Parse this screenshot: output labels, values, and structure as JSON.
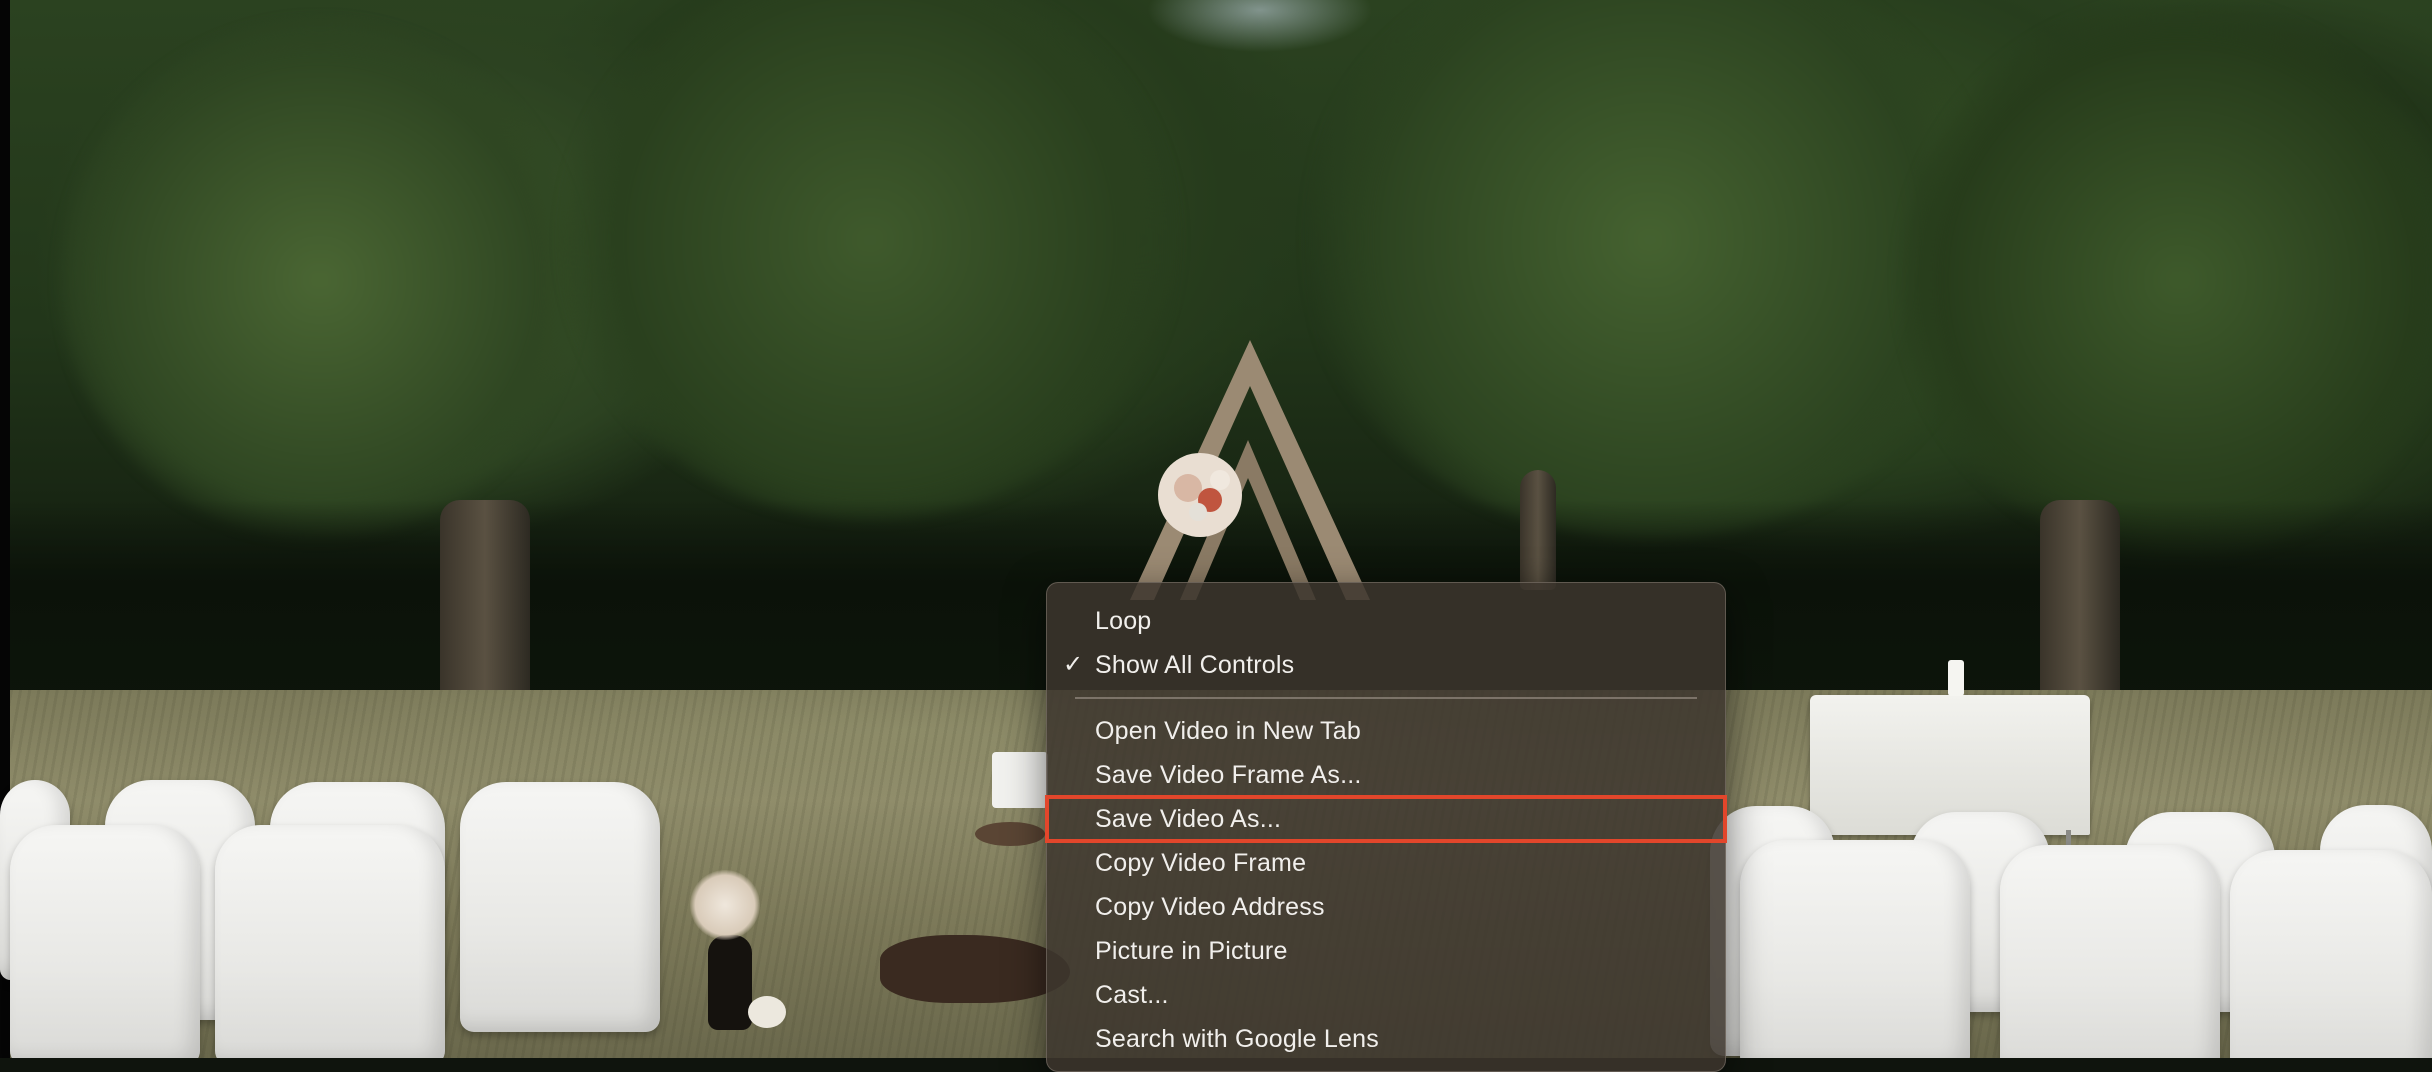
{
  "context_menu": {
    "items": [
      {
        "label": "Loop",
        "checked": false
      },
      {
        "label": "Show All Controls",
        "checked": true
      },
      {
        "label": "Open Video in New Tab",
        "checked": false
      },
      {
        "label": "Save Video Frame As...",
        "checked": false
      },
      {
        "label": "Save Video As...",
        "checked": false,
        "highlighted": true
      },
      {
        "label": "Copy Video Frame",
        "checked": false
      },
      {
        "label": "Copy Video Address",
        "checked": false
      },
      {
        "label": "Picture in Picture",
        "checked": false
      },
      {
        "label": "Cast...",
        "checked": false
      },
      {
        "label": "Search with Google Lens",
        "checked": false
      }
    ],
    "check_glyph": "✓"
  },
  "colors": {
    "highlight_border": "#e2462b",
    "menu_background": "#3c352d",
    "menu_text": "#f1efec"
  }
}
